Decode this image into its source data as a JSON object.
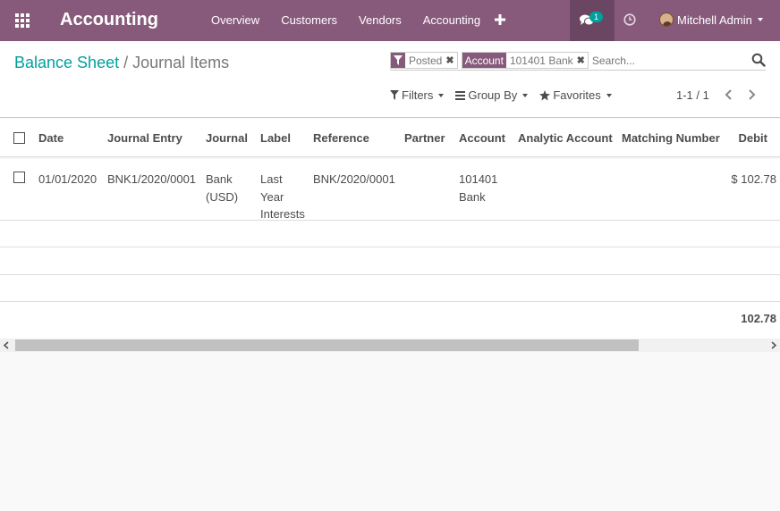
{
  "nav": {
    "brand": "Accounting",
    "menu": [
      "Overview",
      "Customers",
      "Vendors",
      "Accounting"
    ],
    "chat_badge": "1",
    "user": "Mitchell Admin"
  },
  "breadcrumb": {
    "parent": "Balance Sheet",
    "separator": "/",
    "current": "Journal Items"
  },
  "search": {
    "facets": [
      {
        "label": "",
        "value": "Posted"
      },
      {
        "label": "Account",
        "value": "101401 Bank"
      }
    ],
    "placeholder": "Search..."
  },
  "filters": {
    "filters": "Filters",
    "group_by": "Group By",
    "favorites": "Favorites"
  },
  "pager": {
    "text": "1-1 / 1"
  },
  "table": {
    "columns": [
      "Date",
      "Journal Entry",
      "Journal",
      "Label",
      "Reference",
      "Partner",
      "Account",
      "Analytic Account",
      "Matching Number",
      "Debit"
    ],
    "rows": [
      {
        "date": "01/01/2020",
        "journal_entry": "BNK1/2020/0001",
        "journal": "Bank\n(USD)",
        "label": "Last\nYear\nInterests",
        "reference": "BNK/2020/0001",
        "partner": "",
        "account": "101401\nBank",
        "analytic_account": "",
        "matching_number": "",
        "debit": "$ 102.78"
      }
    ],
    "total_debit": "102.78"
  },
  "colors": {
    "brand": "#875a7b",
    "teal": "#00a09d"
  }
}
